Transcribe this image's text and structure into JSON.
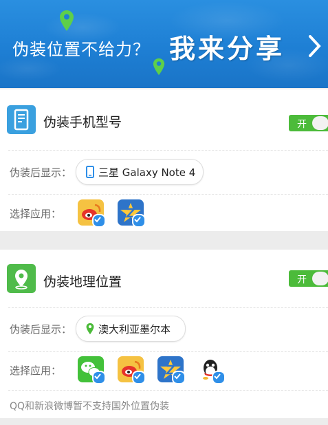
{
  "banner": {
    "text": "伪装位置不给力？",
    "share": "我来分享"
  },
  "device_section": {
    "title": "伪装手机型号",
    "toggle": "开",
    "display_label": "伪装后显示：",
    "display_value": "三星 Galaxy Note 4",
    "apps_label": "选择应用：",
    "apps": [
      "weibo-icon",
      "zhifu-icon"
    ]
  },
  "location_section": {
    "title": "伪装地理位置",
    "toggle": "开",
    "display_label": "伪装后显示：",
    "display_value": "澳大利亚墨尔本",
    "apps_label": "选择应用：",
    "apps": [
      "wechat-icon",
      "weibo-icon",
      "zhifu-icon",
      "qq-icon"
    ],
    "note": "QQ和新浪微博暂不支持国外位置伪装"
  },
  "colors": {
    "toggle_on": "#4cbb3a",
    "banner": "#1e7fd4",
    "check_badge": "#2f8fe8"
  }
}
